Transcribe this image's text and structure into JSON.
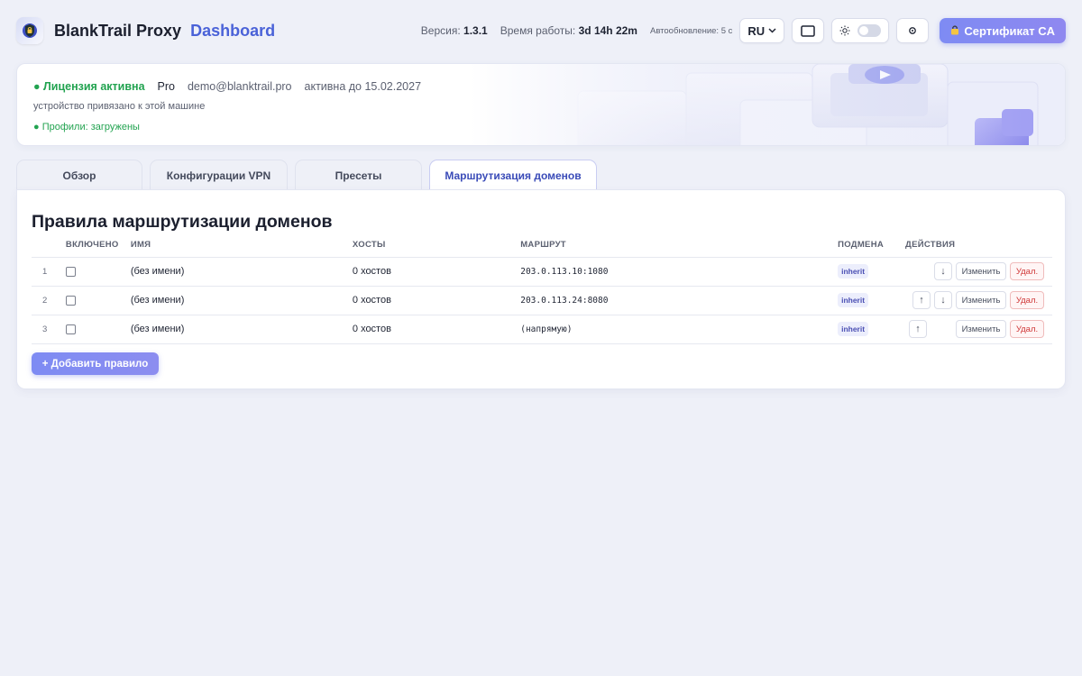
{
  "header": {
    "brand": "BlankTrail Proxy",
    "brand_sub": "Dashboard",
    "version_label": "Версия:",
    "version_value": "1.3.1",
    "uptime_label": "Время работы:",
    "uptime_value": "3d 14h 22m",
    "autorefresh": "Автообновление: 5 с",
    "language": "RU",
    "ca_button": "Сертификат CA"
  },
  "license": {
    "status": "● Лицензия активна",
    "plan": "Pro",
    "email": "demo@blanktrail.pro",
    "valid_until": "активна до 15.02.2027",
    "device_note": "устройство привязано к этой машине",
    "profiles": "● Профили: загружены"
  },
  "tabs": [
    {
      "label": "Обзор",
      "active": false
    },
    {
      "label": "Конфигурации VPN",
      "active": false
    },
    {
      "label": "Пресеты",
      "active": false
    },
    {
      "label": "Маршрутизация доменов",
      "active": true
    }
  ],
  "rules": {
    "title": "Правила маршрутизации доменов",
    "columns": {
      "enabled": "ВКЛЮЧЕНО",
      "name": "ИМЯ",
      "hosts": "ХОСТЫ",
      "route": "МАРШРУТ",
      "spoof": "ПОДМЕНА",
      "actions": "ДЕЙСТВИЯ"
    },
    "rows": [
      {
        "index": "1",
        "name": "(без имени)",
        "hosts": "0 хостов",
        "route": "203.0.113.10:1080",
        "spoof": "inherit"
      },
      {
        "index": "2",
        "name": "(без имени)",
        "hosts": "0 хостов",
        "route": "203.0.113.24:8080",
        "spoof": "inherit"
      },
      {
        "index": "3",
        "name": "(без имени)",
        "hosts": "0 хостов",
        "route": "(напрямую)",
        "spoof": "inherit"
      }
    ],
    "edit_label": "Изменить",
    "delete_label": "Удал.",
    "up_arrow": "↑",
    "down_arrow": "↓",
    "add_button": "+ Добавить правило"
  },
  "colors": {
    "accent": "#4a62d8",
    "active_green": "#22a350",
    "danger": "#d03a3a"
  }
}
